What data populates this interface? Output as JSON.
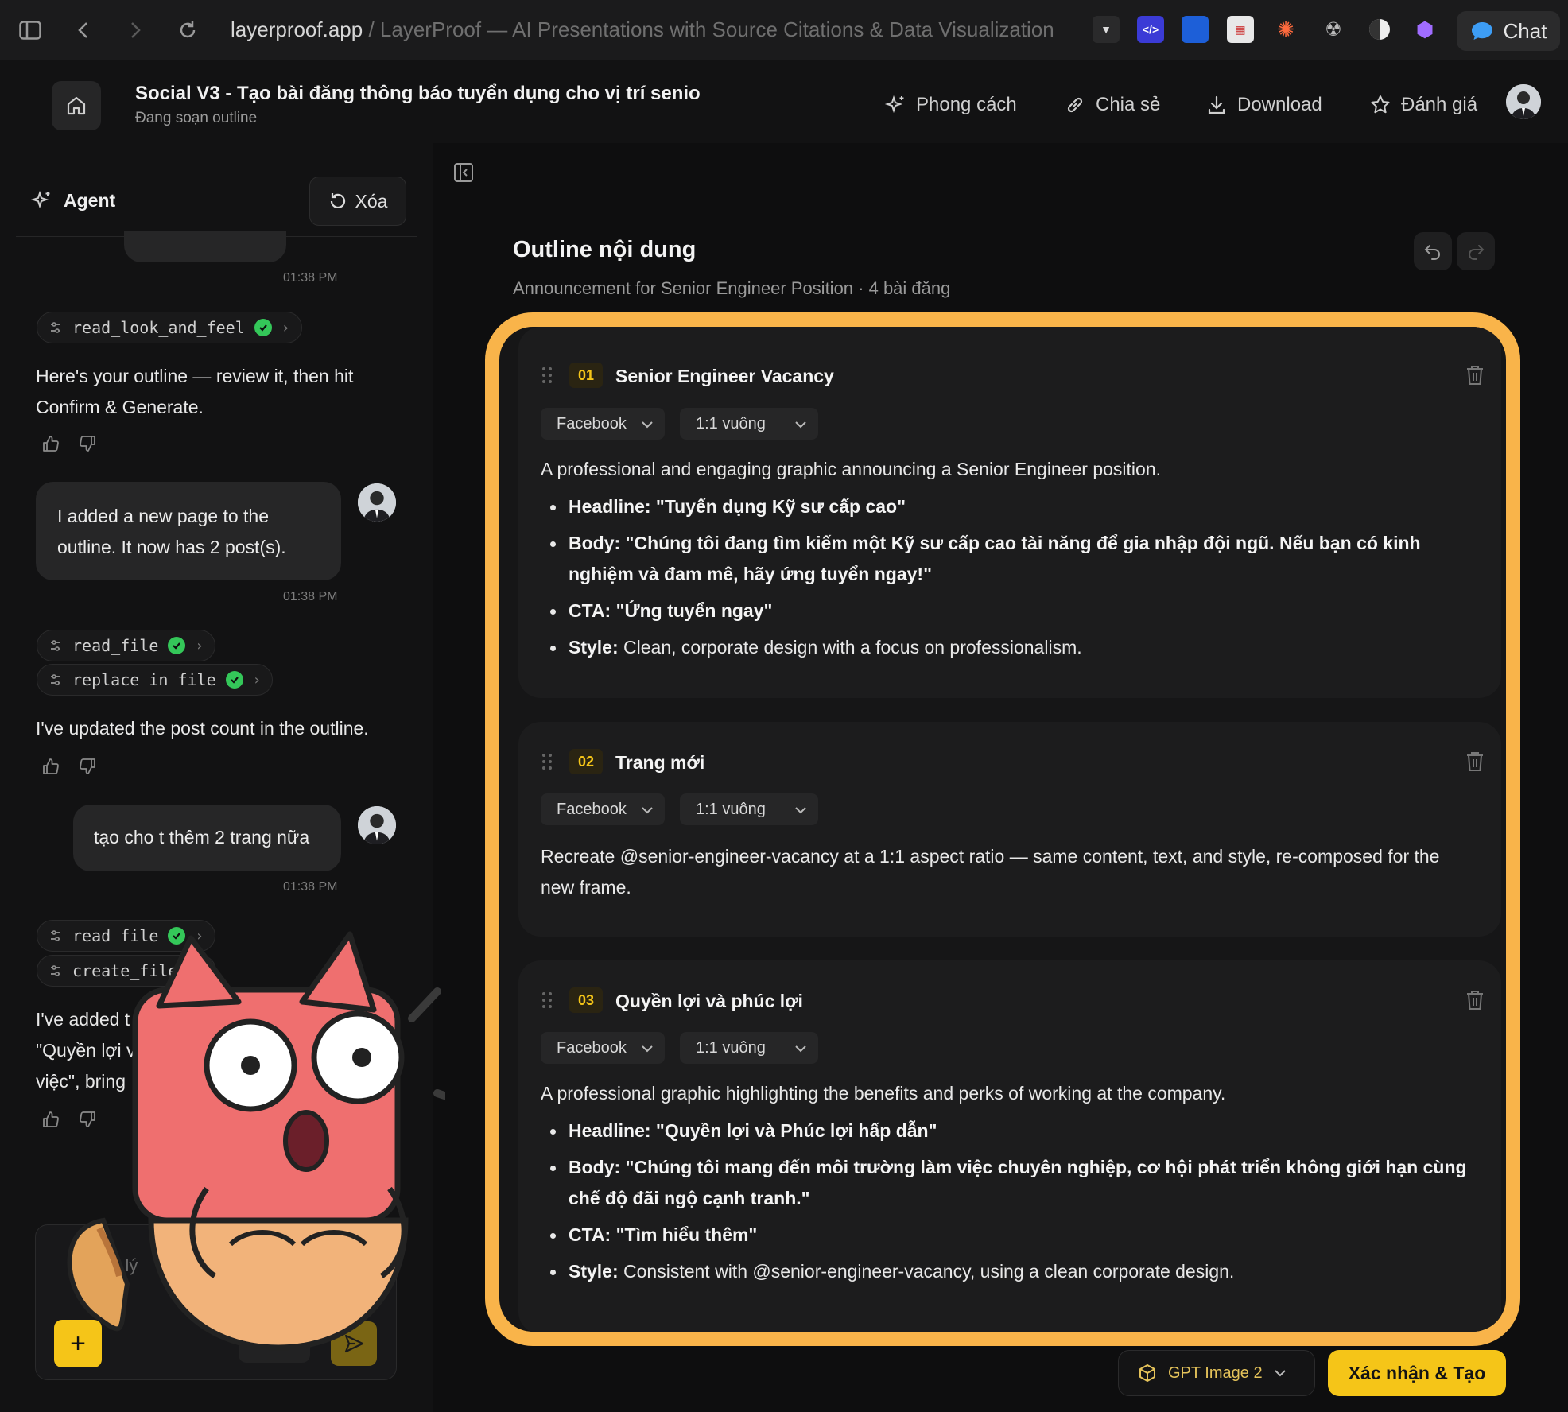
{
  "browser": {
    "url_host": "layerproof.app",
    "url_sep": " / ",
    "url_title": "LayerProof — AI Presentations with Source Citations & Data Visualization",
    "chat_label": "Chat"
  },
  "header": {
    "title": "Social V3 - Tạo bài đăng thông báo tuyển dụng cho vị trí senio",
    "subtitle": "Đang soạn outline",
    "actions": [
      {
        "label": "Phong cách",
        "icon": "sparkle-icon"
      },
      {
        "label": "Chia sẻ",
        "icon": "link-icon"
      },
      {
        "label": "Download",
        "icon": "download-icon"
      },
      {
        "label": "Đánh giá",
        "icon": "star-icon"
      }
    ]
  },
  "agent_panel": {
    "title": "Agent",
    "clear_label": "Xóa",
    "messages": {
      "ts1": "01:38 PM",
      "tool_read_look": "read_look_and_feel",
      "agent1": "Here's your outline — review it, then hit Confirm & Generate.",
      "user1": "I added a new page to the outline. It now has 2 post(s).",
      "ts2": "01:38 PM",
      "tool_read_file_1": "read_file",
      "tool_replace": "replace_in_file",
      "agent2": "I've updated the post count in the outline.",
      "user2": "tạo cho t thêm 2 trang nữa",
      "ts3": "01:38 PM",
      "tool_read_file_2": "read_file",
      "tool_create_file": "create_file",
      "agent3_l1": "I've added t",
      "agent3_l2": "\"Quyền lợi v",
      "agent3_l3": "việc\", bring",
      "composer_hint": "ợ lý"
    }
  },
  "outline": {
    "title": "Outline nội dung",
    "subtitle": "Announcement for Senior Engineer Position · 4 bài đăng",
    "cards": [
      {
        "number": "01",
        "title": "Senior Engineer Vacancy",
        "platform": "Facebook",
        "ratio": "1:1 vuông",
        "description": "A professional and engaging graphic announcing a Senior Engineer position.",
        "bullets": [
          {
            "key": "Headline:",
            "value": " \"Tuyển dụng Kỹ sư cấp cao\"",
            "bold_value": true
          },
          {
            "key": "Body:",
            "value": " \"Chúng tôi đang tìm kiếm một Kỹ sư cấp cao tài năng để gia nhập đội ngũ. Nếu bạn có kinh nghiệm và đam mê, hãy ứng tuyển ngay!\"",
            "bold_value": true
          },
          {
            "key": "CTA:",
            "value": " \"Ứng tuyển ngay\"",
            "bold_value": true
          },
          {
            "key": "Style:",
            "value": " Clean, corporate design with a focus on professionalism.",
            "bold_value": false
          }
        ]
      },
      {
        "number": "02",
        "title": "Trang mới",
        "platform": "Facebook",
        "ratio": "1:1 vuông",
        "description": "Recreate @senior-engineer-vacancy at a 1:1 aspect ratio — same content, text, and style, re-composed for the new frame."
      },
      {
        "number": "03",
        "title": "Quyền lợi và phúc lợi",
        "platform": "Facebook",
        "ratio": "1:1 vuông",
        "description": "A professional graphic highlighting the benefits and perks of working at the company.",
        "bullets": [
          {
            "key": "Headline:",
            "value": " \"Quyền lợi và Phúc lợi hấp dẫn\"",
            "bold_value": true
          },
          {
            "key": "Body:",
            "value": " \"Chúng tôi mang đến môi trường làm việc chuyên nghiệp, cơ hội phát triển không giới hạn cùng chế độ đãi ngộ cạnh tranh.\"",
            "bold_value": true
          },
          {
            "key": "CTA:",
            "value": " \"Tìm hiểu thêm\"",
            "bold_value": true
          },
          {
            "key": "Style:",
            "value": " Consistent with @senior-engineer-vacancy, using a clean corporate design.",
            "bold_value": false
          }
        ]
      }
    ]
  },
  "footer": {
    "model_label": "GPT Image 2",
    "confirm_label": "Xác nhận & Tạo"
  },
  "colors": {
    "accent": "#f5c518",
    "highlight_frame": "#f9b44a",
    "success": "#34c759"
  }
}
